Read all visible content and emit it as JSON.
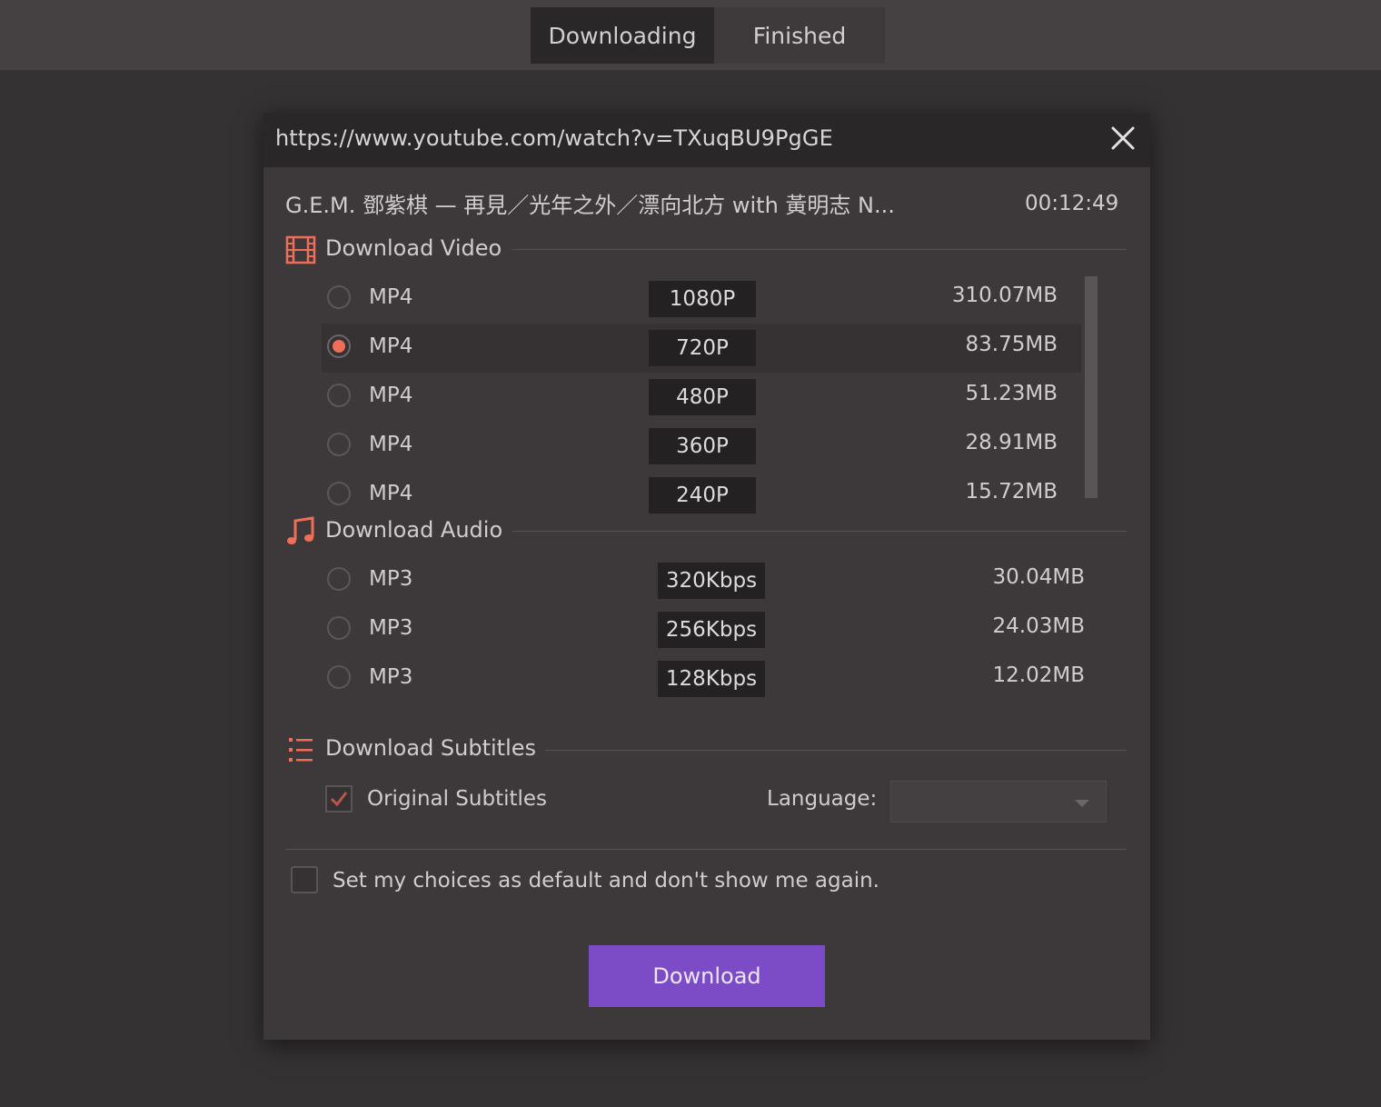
{
  "tabs": [
    {
      "label": "Downloading",
      "active": true
    },
    {
      "label": "Finished",
      "active": false
    }
  ],
  "dialog": {
    "url": "https://www.youtube.com/watch?v=TXuqBU9PgGE",
    "title": "G.E.M. 鄧紫棋 — 再見／光年之外／漂向北方 with 黃明志 N...",
    "duration": "00:12:49",
    "accent_color": "#f06e58",
    "video_section": {
      "label": "Download Video",
      "icon": "film-icon",
      "options": [
        {
          "format": "MP4",
          "quality": "1080P",
          "size": "310.07MB",
          "selected": false
        },
        {
          "format": "MP4",
          "quality": "720P",
          "size": "83.75MB",
          "selected": true
        },
        {
          "format": "MP4",
          "quality": "480P",
          "size": "51.23MB",
          "selected": false
        },
        {
          "format": "MP4",
          "quality": "360P",
          "size": "28.91MB",
          "selected": false
        },
        {
          "format": "MP4",
          "quality": "240P",
          "size": "15.72MB",
          "selected": false
        }
      ]
    },
    "audio_section": {
      "label": "Download Audio",
      "icon": "music-note-icon",
      "options": [
        {
          "format": "MP3",
          "quality": "320Kbps",
          "size": "30.04MB",
          "selected": false
        },
        {
          "format": "MP3",
          "quality": "256Kbps",
          "size": "24.03MB",
          "selected": false
        },
        {
          "format": "MP3",
          "quality": "128Kbps",
          "size": "12.02MB",
          "selected": false
        }
      ]
    },
    "subtitles_section": {
      "label": "Download Subtitles",
      "icon": "list-icon",
      "original_subtitles_label": "Original Subtitles",
      "original_subtitles_checked": true,
      "language_label": "Language:",
      "language_value": ""
    },
    "default_choice_label": "Set my choices as default and don't show me again.",
    "default_choice_checked": false,
    "download_button": {
      "label": "Download",
      "color": "#7b4cc6"
    }
  }
}
